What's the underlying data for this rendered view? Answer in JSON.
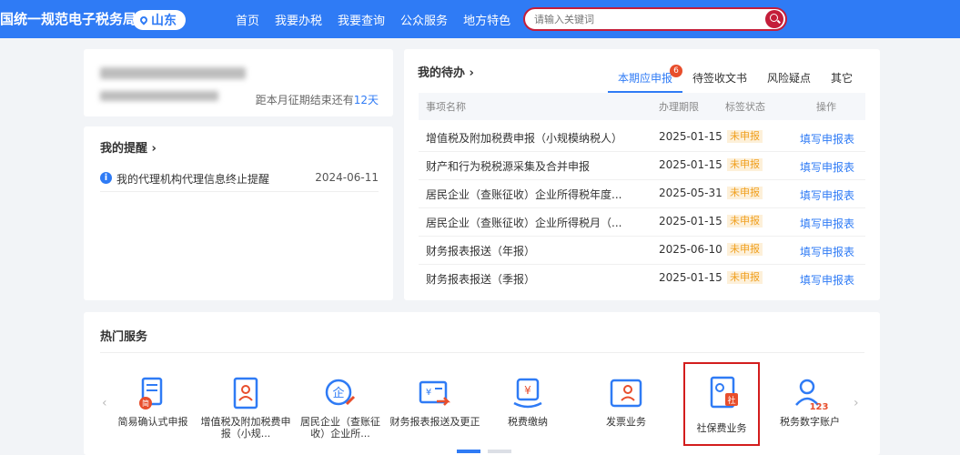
{
  "header": {
    "brand": "国统一规范电子税务局",
    "region": "山东",
    "nav": [
      "首页",
      "我要办税",
      "我要查询",
      "公众服务",
      "地方特色"
    ],
    "search_placeholder": "请输入关键词"
  },
  "user": {
    "deadline_prefix": "距本月征期结束还有",
    "deadline_days": "12天"
  },
  "remind": {
    "title": "我的提醒",
    "item_text": "我的代理机构代理信息终止提醒",
    "item_date": "2024-06-11"
  },
  "todo": {
    "title": "我的待办",
    "tabs": [
      "本期应申报",
      "待签收文书",
      "风险疑点",
      "其它"
    ],
    "badge": "6",
    "columns": [
      "事项名称",
      "办理期限",
      "标签状态",
      "操作"
    ],
    "rows": [
      {
        "name": "增值税及附加税费申报（小规模纳税人）",
        "deadline": "2025-01-15",
        "status": "未申报",
        "action": "填写申报表"
      },
      {
        "name": "财产和行为税税源采集及合并申报",
        "deadline": "2025-01-15",
        "status": "未申报",
        "action": "填写申报表"
      },
      {
        "name": "居民企业（查账征收）企业所得税年度...",
        "deadline": "2025-05-31",
        "status": "未申报",
        "action": "填写申报表"
      },
      {
        "name": "居民企业（查账征收）企业所得税月（...",
        "deadline": "2025-01-15",
        "status": "未申报",
        "action": "填写申报表"
      },
      {
        "name": "财务报表报送（年报）",
        "deadline": "2025-06-10",
        "status": "未申报",
        "action": "填写申报表"
      },
      {
        "name": "财务报表报送（季报）",
        "deadline": "2025-01-15",
        "status": "未申报",
        "action": "填写申报表"
      }
    ]
  },
  "hot": {
    "title": "热门服务",
    "services": [
      {
        "label": "简易确认式申报",
        "icon": "simple-declare-icon"
      },
      {
        "label": "增值税及附加税费申报（小规...",
        "icon": "vat-declare-icon"
      },
      {
        "label": "居民企业（查账征收）企业所...",
        "icon": "enterprise-tax-icon"
      },
      {
        "label": "财务报表报送及更正",
        "icon": "financial-report-icon"
      },
      {
        "label": "税费缴纳",
        "icon": "tax-payment-icon"
      },
      {
        "label": "发票业务",
        "icon": "invoice-icon"
      },
      {
        "label": "社保费业务",
        "icon": "social-security-icon"
      },
      {
        "label": "税务数字账户",
        "icon": "digital-account-icon"
      }
    ]
  },
  "colors": {
    "primary": "#2f7bf5",
    "accent_red": "#c41e3a",
    "warn": "#f0a020"
  }
}
